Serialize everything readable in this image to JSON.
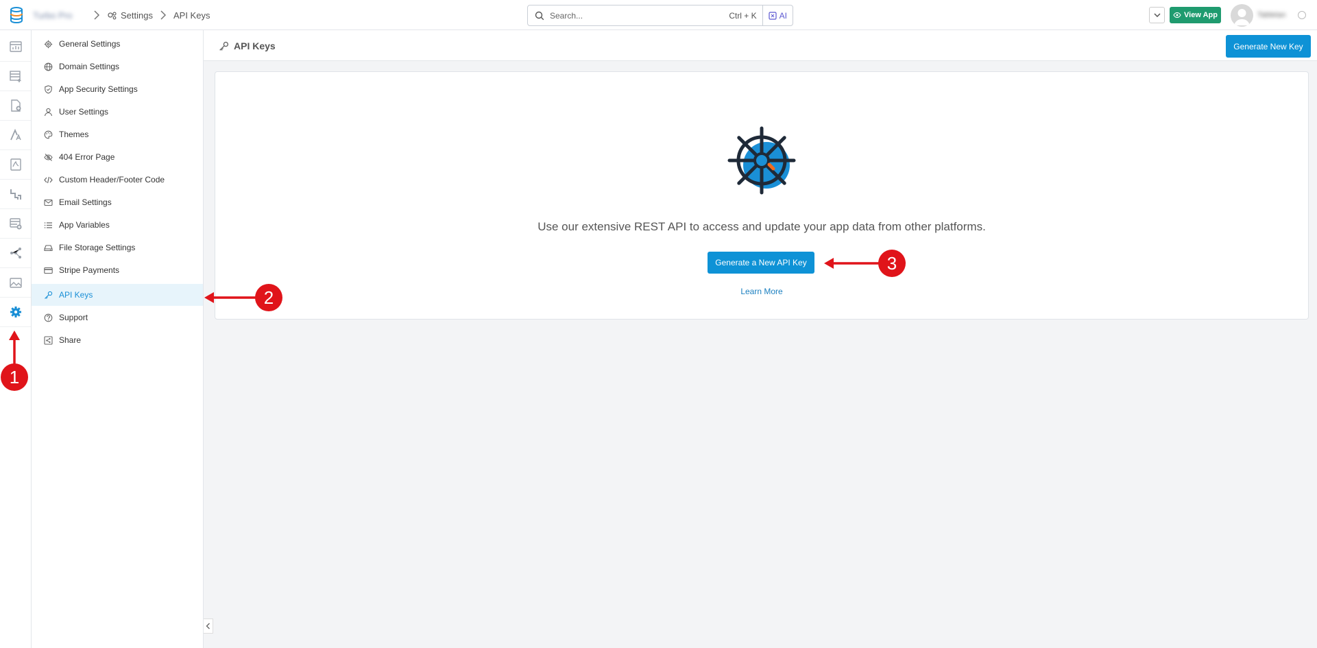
{
  "topbar": {
    "app_name": "Turbo Pro",
    "breadcrumb": [
      {
        "label": "Settings"
      },
      {
        "label": "API Keys"
      }
    ],
    "search": {
      "placeholder": "Search...",
      "shortcut": "Ctrl + K",
      "ai_label": "AI"
    },
    "view_app_label": "View App",
    "user_name": "Tabletan"
  },
  "rail": {
    "items": [
      {
        "icon": "dashboard-icon"
      },
      {
        "icon": "table-add-icon"
      },
      {
        "icon": "document-add-icon"
      },
      {
        "icon": "font-icon"
      },
      {
        "icon": "pdf-icon"
      },
      {
        "icon": "pipes-icon"
      },
      {
        "icon": "database-add-icon"
      },
      {
        "icon": "workflow-icon"
      },
      {
        "icon": "image-icon"
      },
      {
        "icon": "gear-icon",
        "active": true
      }
    ],
    "help_label": "?"
  },
  "sidebar": {
    "items": [
      {
        "label": "General Settings",
        "icon": "gear-icon"
      },
      {
        "label": "Domain Settings",
        "icon": "globe-icon"
      },
      {
        "label": "App Security Settings",
        "icon": "shield-icon"
      },
      {
        "label": "User Settings",
        "icon": "user-icon"
      },
      {
        "label": "Themes",
        "icon": "palette-icon"
      },
      {
        "label": "404 Error Page",
        "icon": "eye-off-icon"
      },
      {
        "label": "Custom Header/Footer Code",
        "icon": "code-icon"
      },
      {
        "label": "Email Settings",
        "icon": "mail-icon"
      },
      {
        "label": "App Variables",
        "icon": "list-icon"
      },
      {
        "label": "File Storage Settings",
        "icon": "drive-icon"
      },
      {
        "label": "Stripe Payments",
        "icon": "card-icon"
      },
      {
        "label": "API Keys",
        "icon": "key-icon",
        "active": true
      },
      {
        "label": "Support",
        "icon": "help-circle-icon"
      },
      {
        "label": "Share",
        "icon": "share-icon"
      }
    ]
  },
  "main": {
    "title": "API Keys",
    "generate_new_key_label": "Generate New Key",
    "card": {
      "illustration": "ship-wheel-icon",
      "description": "Use our extensive REST API to access and update your app data from other platforms.",
      "button_label": "Generate a New API Key",
      "learn_more_label": "Learn More"
    }
  },
  "annotations": [
    {
      "number": "1"
    },
    {
      "number": "2"
    },
    {
      "number": "3"
    }
  ],
  "colors": {
    "accent": "#0e92d6",
    "view_app": "#1f9b6f",
    "annotation": "#e0141a",
    "active_bg": "#e7f4fb"
  }
}
